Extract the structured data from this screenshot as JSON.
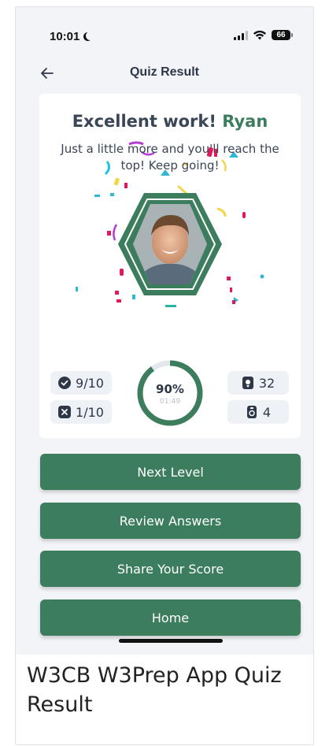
{
  "status_bar": {
    "time": "10:01",
    "battery": "66",
    "icons": [
      "moon-icon",
      "signal-icon",
      "wifi-icon",
      "battery-icon"
    ]
  },
  "header": {
    "title": "Quiz Result",
    "back_icon": "arrow-left-icon"
  },
  "result": {
    "headline_prefix": "Excellent work! ",
    "user_name": "Ryan",
    "message": "Just a little more and you'll reach the top! Keep going!",
    "avatar_icon": "user-avatar-photo",
    "stats": {
      "correct": "9/10",
      "wrong": "1/10",
      "points": "32",
      "coins": "4"
    },
    "progress": {
      "percent_label": "90%",
      "fraction": 0.9,
      "time": "01:49"
    }
  },
  "buttons": {
    "next_level": "Next Level",
    "review_answers": "Review Answers",
    "share_score": "Share Your Score",
    "home": "Home"
  },
  "caption": "W3CB W3Prep App Quiz Result",
  "colors": {
    "accent": "#3b7d5c",
    "background": "#f2f4f7",
    "card": "#ffffff",
    "text": "#2d3748"
  }
}
